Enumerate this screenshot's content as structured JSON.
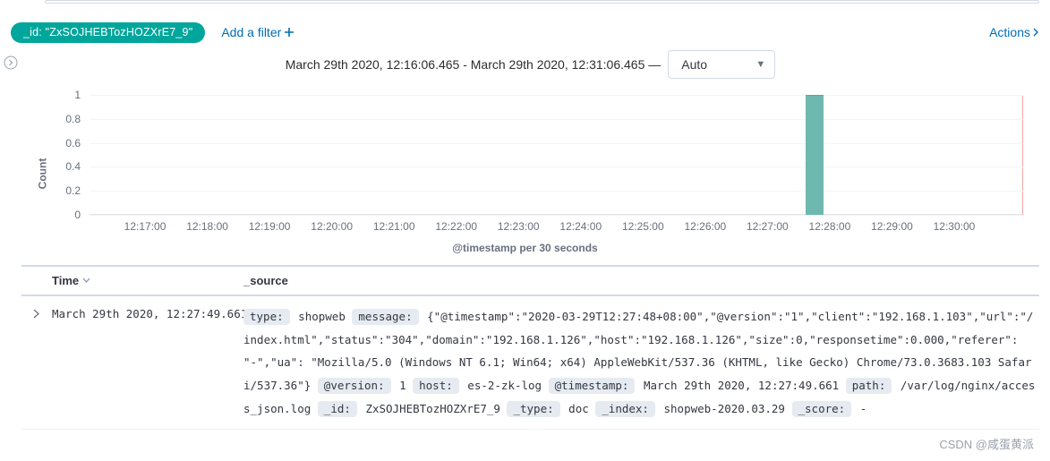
{
  "filterbar": {
    "pill_label": "_id: \"ZxSOJHEBTozHOZXrE7_9\"",
    "add_filter_label": "Add a filter",
    "actions_label": "Actions"
  },
  "histogram": {
    "range_text": "March 29th 2020, 12:16:06.465 - March 29th 2020, 12:31:06.465 —",
    "interval_selected": "Auto",
    "y_title": "Count",
    "x_title": "@timestamp per 30 seconds",
    "y_ticks": [
      "1",
      "0.8",
      "0.6",
      "0.4",
      "0.2",
      "0"
    ],
    "x_ticks": [
      "12:17:00",
      "12:18:00",
      "12:19:00",
      "12:20:00",
      "12:21:00",
      "12:22:00",
      "12:23:00",
      "12:24:00",
      "12:25:00",
      "12:26:00",
      "12:27:00",
      "12:28:00",
      "12:29:00",
      "12:30:00"
    ]
  },
  "chart_data": {
    "type": "bar",
    "title": "",
    "xlabel": "@timestamp per 30 seconds",
    "ylabel": "Count",
    "ylim": [
      0,
      1
    ],
    "categories": [
      "12:27:30"
    ],
    "values": [
      1
    ]
  },
  "table": {
    "headers": {
      "time": "Time",
      "source": "_source"
    },
    "row": {
      "time": "March 29th 2020, 12:27:49.661",
      "fields": {
        "type_k": "type:",
        "type_v": "shopweb",
        "message_k": "message:",
        "message_v": "{\"@timestamp\":\"2020-03-29T12:27:48+08:00\",\"@version\":\"1\",\"client\":\"192.168.1.103\",\"url\":\"/index.html\",\"status\":\"304\",\"domain\":\"192.168.1.126\",\"host\":\"192.168.1.126\",\"size\":0,\"responsetime\":0.000,\"referer\": \"-\",\"ua\": \"Mozilla/5.0 (Windows NT 6.1; Win64; x64) AppleWebKit/537.36 (KHTML, like Gecko) Chrome/73.0.3683.103 Safari/537.36\"}",
        "atversion_k": "@version:",
        "atversion_v": "1",
        "host_k": "host:",
        "host_v": "es-2-zk-log",
        "attimestamp_k": "@timestamp:",
        "attimestamp_v": "March 29th 2020, 12:27:49.661",
        "path_k": "path:",
        "path_v": "/var/log/nginx/access_json.log",
        "id_k": "_id:",
        "id_v": "ZxSOJHEBTozHOZXrE7_9",
        "dtype_k": "_type:",
        "dtype_v": "doc",
        "index_k": "_index:",
        "index_v": "shopweb-2020.03.29",
        "score_k": "_score:",
        "score_v": " -"
      }
    }
  },
  "watermark": "CSDN @咸蛋黄派"
}
